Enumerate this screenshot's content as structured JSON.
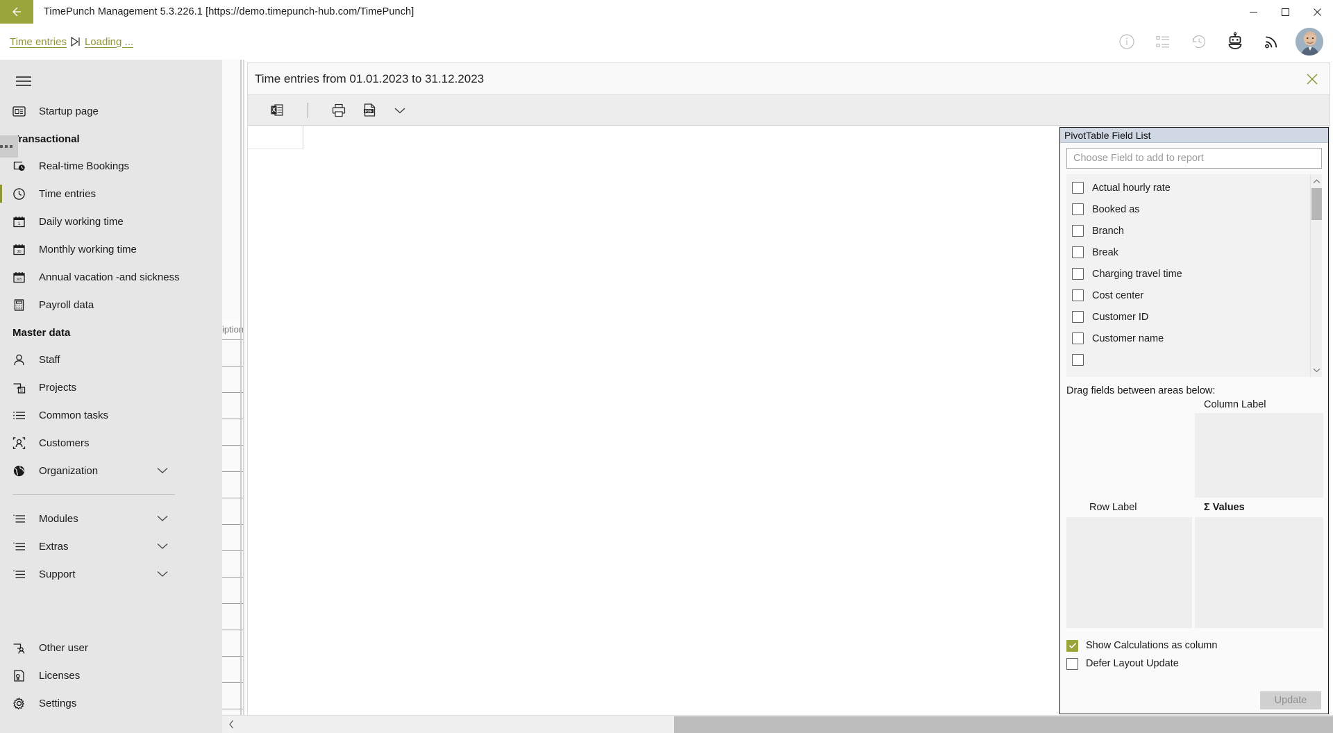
{
  "window": {
    "title": "TimePunch Management 5.3.226.1 [https://demo.timepunch-hub.com/TimePunch]",
    "back_icon": "back-arrow-icon",
    "accent_color": "#9aa53c",
    "minimize_label": "─",
    "maximize_label": "□",
    "close_label": "✕"
  },
  "tabbar": {
    "crumbs": [
      {
        "label": "Time entries"
      },
      {
        "label": "Loading ..."
      }
    ],
    "separator_icon": "play-to-end-icon",
    "icons": [
      {
        "name": "info-icon"
      },
      {
        "name": "task-list-icon"
      },
      {
        "name": "history-icon"
      },
      {
        "name": "robot-icon"
      },
      {
        "name": "rss-feed-icon"
      }
    ],
    "avatar_name": "user-avatar"
  },
  "sidebar": {
    "menu_icon": "hamburger-menu-icon",
    "items": [
      {
        "label": "Startup page",
        "icon": "startup-page-icon",
        "type": "item",
        "active": false
      },
      {
        "label": "Transactional",
        "type": "header"
      },
      {
        "label": "Real-time Bookings",
        "icon": "realtime-bookings-icon",
        "type": "item",
        "active": false
      },
      {
        "label": "Time entries",
        "icon": "clock-icon",
        "type": "item",
        "active": true
      },
      {
        "label": "Daily working time",
        "icon": "calendar-day-icon",
        "type": "item",
        "active": false
      },
      {
        "label": "Monthly working time",
        "icon": "calendar-month-icon",
        "type": "item",
        "active": false
      },
      {
        "label": "Annual vacation -and sickness",
        "icon": "calendar-year-icon",
        "type": "item",
        "active": false
      },
      {
        "label": "Payroll data",
        "icon": "calculator-icon",
        "type": "item",
        "active": false
      },
      {
        "label": "Master data",
        "type": "header"
      },
      {
        "label": "Staff",
        "icon": "person-icon",
        "type": "item",
        "active": false
      },
      {
        "label": "Projects",
        "icon": "projects-icon",
        "type": "item",
        "active": false
      },
      {
        "label": "Common tasks",
        "icon": "list-icon",
        "type": "item",
        "active": false
      },
      {
        "label": "Customers",
        "icon": "customers-icon",
        "type": "item",
        "active": false
      },
      {
        "label": "Organization",
        "icon": "globe-icon",
        "type": "item",
        "active": false,
        "expandable": true
      },
      {
        "type": "divider"
      },
      {
        "label": "Modules",
        "icon": "modules-icon",
        "type": "item",
        "active": false,
        "expandable": true
      },
      {
        "label": "Extras",
        "icon": "extras-icon",
        "type": "item",
        "active": false,
        "expandable": true
      },
      {
        "label": "Support",
        "icon": "support-icon",
        "type": "item",
        "active": false,
        "expandable": true
      },
      {
        "type": "spacer"
      },
      {
        "label": "Other user",
        "icon": "other-user-icon",
        "type": "item",
        "active": false
      },
      {
        "label": "Licenses",
        "icon": "license-icon",
        "type": "item",
        "active": false
      },
      {
        "label": "Settings",
        "icon": "gear-icon",
        "type": "item",
        "active": false
      }
    ],
    "collapse_icon": "chevron-left-icon"
  },
  "hidden_grid": {
    "column_header_fragment": "iption",
    "overflow_button": "•••"
  },
  "content": {
    "title": "Time entries from 01.01.2023 to 31.12.2023",
    "close_icon": "close-icon",
    "toolbar": [
      {
        "name": "export-excel-button",
        "icon": "excel-icon",
        "label": "X"
      },
      {
        "name": "toolbar-separator",
        "icon": "separator"
      },
      {
        "name": "print-button",
        "icon": "printer-icon"
      },
      {
        "name": "export-pdf-button",
        "icon": "pdf-icon",
        "label": "PDF"
      },
      {
        "name": "export-dropdown-button",
        "icon": "chevron-down-icon"
      }
    ]
  },
  "pivot": {
    "title": "PivotTable Field List",
    "search_placeholder": "Choose Field to add to report",
    "search_value": "",
    "fields": [
      {
        "label": "Actual hourly rate",
        "checked": false
      },
      {
        "label": "Booked as",
        "checked": false
      },
      {
        "label": "Branch",
        "checked": false
      },
      {
        "label": "Break",
        "checked": false
      },
      {
        "label": "Charging travel time",
        "checked": false
      },
      {
        "label": "Cost center",
        "checked": false
      },
      {
        "label": "Customer ID",
        "checked": false
      },
      {
        "label": "Customer name",
        "checked": false
      },
      {
        "label": "",
        "checked": false
      }
    ],
    "drag_hint": "Drag fields between areas below:",
    "areas": [
      {
        "name": "column-label-area",
        "label": "Column Label"
      },
      {
        "name": "row-label-area",
        "label": "Row Label"
      },
      {
        "name": "values-area",
        "label": "Σ  Values"
      }
    ],
    "options": [
      {
        "label": "Show Calculations as column",
        "checked": true,
        "name": "show-calculations-as-column-checkbox"
      },
      {
        "label": "Defer Layout Update",
        "checked": false,
        "name": "defer-layout-update-checkbox"
      }
    ],
    "update_button": "Update"
  }
}
